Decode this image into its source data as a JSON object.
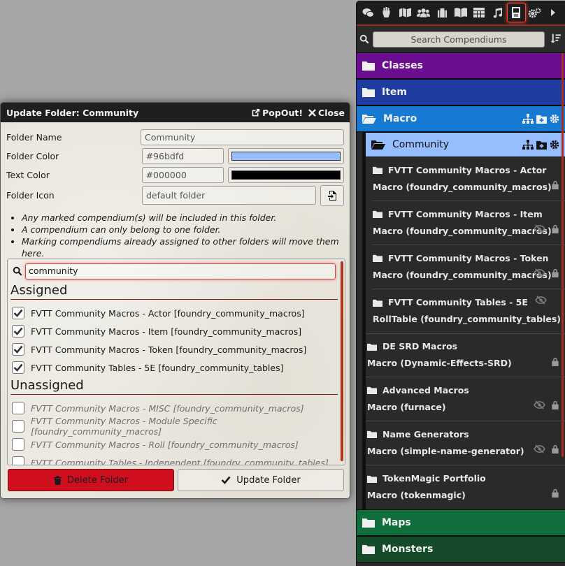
{
  "dialog": {
    "title": "Update Folder: Community",
    "popout_label": "PopOut!",
    "close_label": "Close",
    "fields": {
      "name_label": "Folder Name",
      "name_value": "Community",
      "color_label": "Folder Color",
      "color_value": "#96bdfd",
      "text_color_label": "Text Color",
      "text_color_value": "#000000",
      "icon_label": "Folder Icon",
      "icon_value": "default folder"
    },
    "notes": [
      "Any marked compendium(s) will be included in this folder.",
      "A compendium can only belong to one folder.",
      "Marking compendiums already assigned to other folders will move them here."
    ],
    "search_value": "community",
    "assigned_title": "Assigned",
    "assigned": [
      "FVTT Community Macros - Actor [foundry_community_macros]",
      "FVTT Community Macros - Item [foundry_community_macros]",
      "FVTT Community Macros - Token [foundry_community_macros]",
      "FVTT Community Tables - 5E [foundry_community_tables]"
    ],
    "unassigned_title": "Unassigned",
    "unassigned": [
      "FVTT Community Macros - MISC [foundry_community_macros]",
      "FVTT Community Macros - Module Specific [foundry_community_macros]",
      "FVTT Community Macros - Roll [foundry_community_macros]",
      "FVTT Community Tables - Independent [foundry_community_tables]"
    ],
    "delete_label": "Delete Folder",
    "update_label": "Update Folder"
  },
  "sidebar": {
    "search_placeholder": "Search Compendiums",
    "tabs": [
      "chat-icon",
      "combat-icon",
      "scenes-icon",
      "actors-icon",
      "items-icon",
      "journal-icon",
      "tables-icon",
      "playlists-icon",
      "compendium-icon",
      "settings-icon",
      "collapse-icon"
    ],
    "active_tab": "compendium-icon",
    "folders": {
      "classes": {
        "label": "Classes",
        "color": "#6a0e8f"
      },
      "item": {
        "label": "Item",
        "color": "#1f3ca0"
      },
      "macro": {
        "label": "Macro",
        "color": "#1679d2"
      },
      "community": {
        "label": "Community",
        "color": "#96bdfd"
      },
      "maps": {
        "label": "Maps",
        "color": "#0f6e3c"
      },
      "monsters": {
        "label": "Monsters",
        "color": "#154a2b"
      }
    },
    "community_packs": [
      {
        "title": "FVTT Community Macros - Actor",
        "sub": "Macro (foundry_community_macros)",
        "hidden": false
      },
      {
        "title": "FVTT Community Macros - Item",
        "sub": "Macro (foundry_community_macros)",
        "hidden": true
      },
      {
        "title": "FVTT Community Macros - Token",
        "sub": "Macro (foundry_community_macros)",
        "hidden": true
      },
      {
        "title": "FVTT Community Tables - 5E",
        "sub": "RollTable (foundry_community_tables)",
        "hidden": true
      }
    ],
    "macro_packs": [
      {
        "title": "DE SRD Macros",
        "sub": "Macro (Dynamic-Effects-SRD)",
        "hidden": false
      },
      {
        "title": "Advanced Macros",
        "sub": "Macro (furnace)",
        "hidden": true
      },
      {
        "title": "Name Generators",
        "sub": "Macro (simple-name-generator)",
        "hidden": true
      },
      {
        "title": "TokenMagic Portfolio",
        "sub": "Macro (tokenmagic)",
        "hidden": false
      }
    ]
  }
}
